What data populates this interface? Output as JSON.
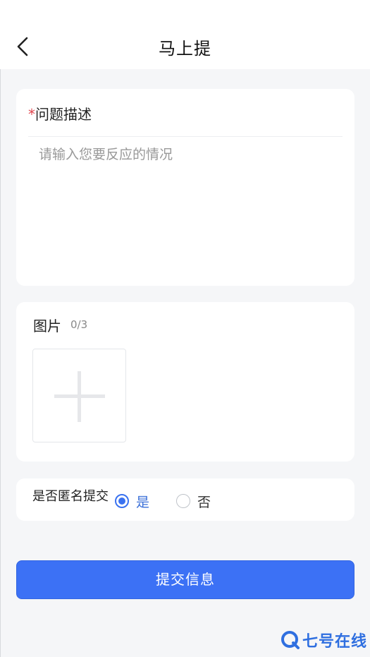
{
  "header": {
    "title": "马上提",
    "back_icon": "chevron-left-icon"
  },
  "description": {
    "required_mark": "*",
    "label": "问题描述",
    "placeholder": "请输入您要反应的情况",
    "value": ""
  },
  "images": {
    "label": "图片",
    "count": "0/3",
    "upload_icon": "plus-icon"
  },
  "anonymous": {
    "label": "是否匿名提交",
    "options": [
      {
        "label": "是",
        "selected": true
      },
      {
        "label": "否",
        "selected": false
      }
    ]
  },
  "submit": {
    "label": "提交信息"
  },
  "watermark": {
    "text": "七号在线",
    "icon": "q-logo-icon"
  },
  "colors": {
    "accent": "#3c71f5",
    "required": "#e0454d",
    "background": "#f5f6f8",
    "card": "#ffffff"
  }
}
